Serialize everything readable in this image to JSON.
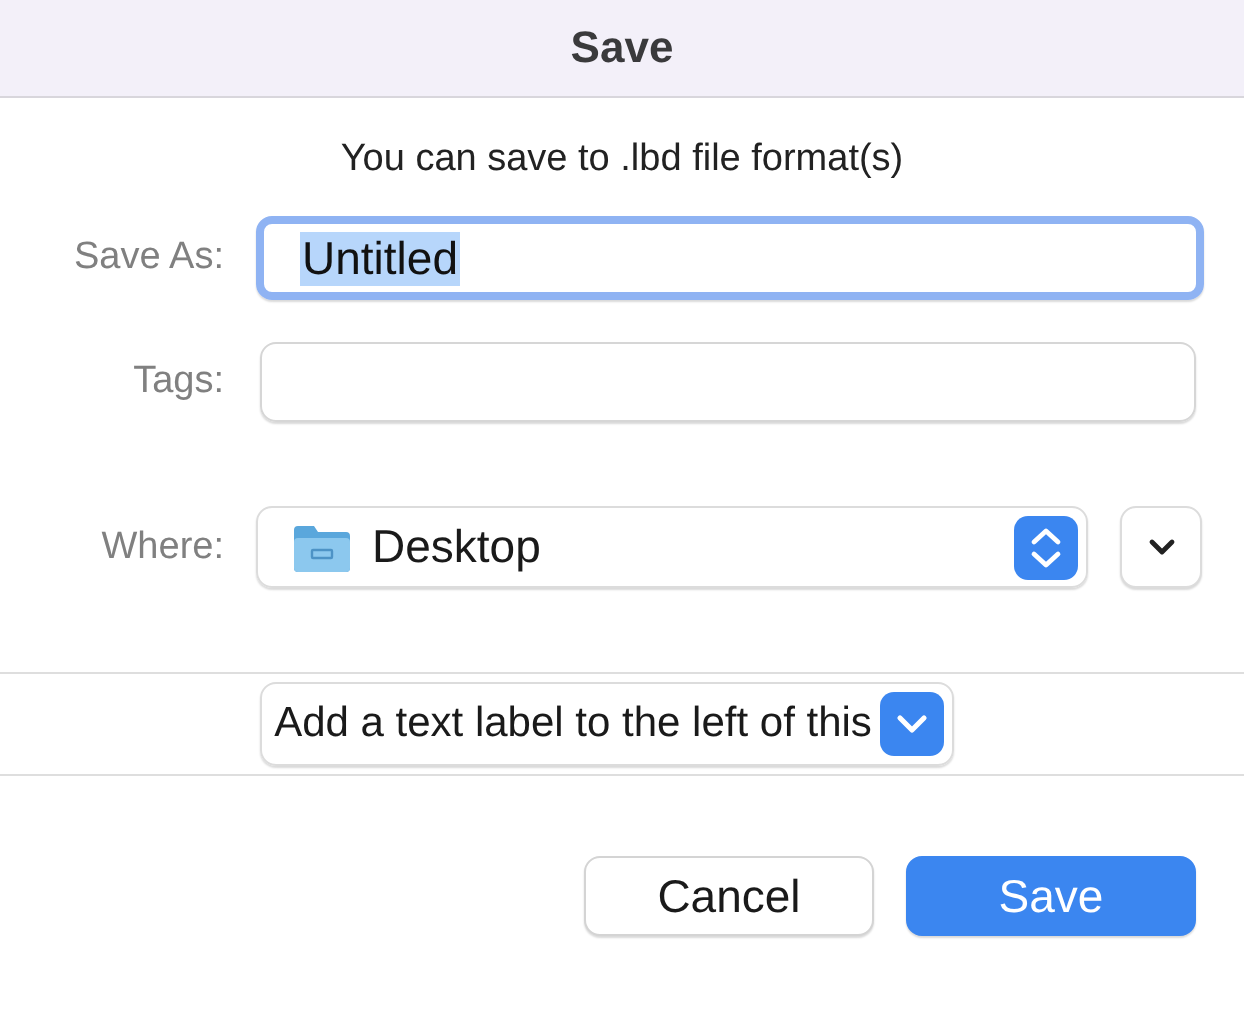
{
  "window": {
    "title": "Save"
  },
  "message": "You can save to .lbd file format(s)",
  "save_as": {
    "label": "Save As:",
    "value": "Untitled",
    "focused": true,
    "text_selected": true
  },
  "tags": {
    "label": "Tags:"
  },
  "where": {
    "label": "Where:",
    "value": "Desktop",
    "expanded": false
  },
  "accessory_popup": {
    "value": "Add a text label to the left of this"
  },
  "buttons": [
    {
      "label": "Cancel",
      "kind": "default"
    },
    {
      "label": "Save",
      "kind": "primary"
    }
  ]
}
